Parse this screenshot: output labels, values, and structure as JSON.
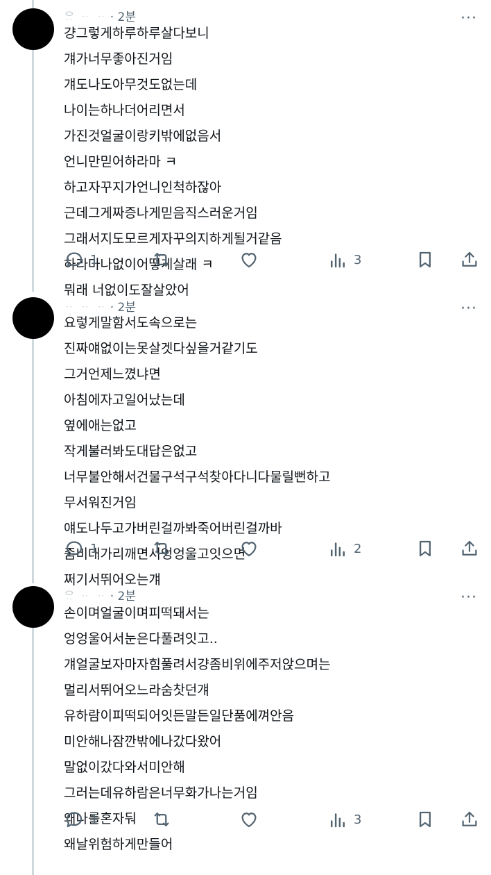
{
  "tweets": [
    {
      "author": "ᄋᆢ ᆢ ᆢ",
      "time": "· 2분",
      "more": "···",
      "lines": [
        "걍그렇게하루하루살다보니",
        "걔가너무좋아진거임",
        "걔도나도아무것도없는데",
        "나이는하나더어리면서",
        "가진것얼굴이랑키밖에없음서",
        "언니만믿어하라마 ㅋ",
        "하고자꾸지가언니인척하잖아",
        "근데그게짜증나게믿음직스러운거임",
        "그래서지도모르게자꾸의지하게될거같음",
        "하라마나없이어떻게살래 ㅋ",
        "뭐래 너없이도잘살았어"
      ],
      "replies": "1",
      "views": "3"
    },
    {
      "author": "ᆢ ᆢ ᆢ",
      "time": "· 2분",
      "more": "···",
      "lines": [
        "요렇게말함서도속으로는",
        "진짜얘없이는못살겟다싶을거같기도",
        "그거언제느꼈냐면",
        "아침에자고일어났는데",
        "옆에애는없고",
        "작게불러봐도대답은없고",
        "너무불안해서건물구석구석찾아다니다물릴뻔하고",
        "무서워진거임",
        "얘도나두고가버린걸까봐죽어버린걸까바",
        "좀비대가리깨면서엉엉울고잇으면",
        "쩌기서뛰어오는걔"
      ],
      "replies": "1",
      "views": "2"
    },
    {
      "author": "ᄋᆢ ᆢ ᆢ",
      "time": "· 2분",
      "more": "···",
      "lines": [
        "손이며얼굴이며피떡돼서는",
        "엉엉울어서눈은다풀려잇고..",
        "걔얼굴보자마자힘풀려서걍좀비위에주저앉으며는",
        "멀리서뛰어오느라숨찻던걔",
        "유하람이피떡되어잇든말든일단품에껴안음",
        "미안해나잠깐밖에나갔다왔어",
        "말없이갔다와서미안해",
        "그러는데유하람은너무화가나는거임",
        "왜나를혼자둬",
        "왜날위험하게만들어"
      ],
      "replies": "1",
      "views": "3"
    }
  ],
  "icons": {
    "reply": "reply-icon",
    "retweet": "retweet-icon",
    "like": "like-icon",
    "views": "views-icon",
    "bookmark": "bookmark-icon",
    "share": "share-icon"
  },
  "colors": {
    "muted": "#536471",
    "thread": "#cfd9de",
    "text": "#0f1419"
  }
}
